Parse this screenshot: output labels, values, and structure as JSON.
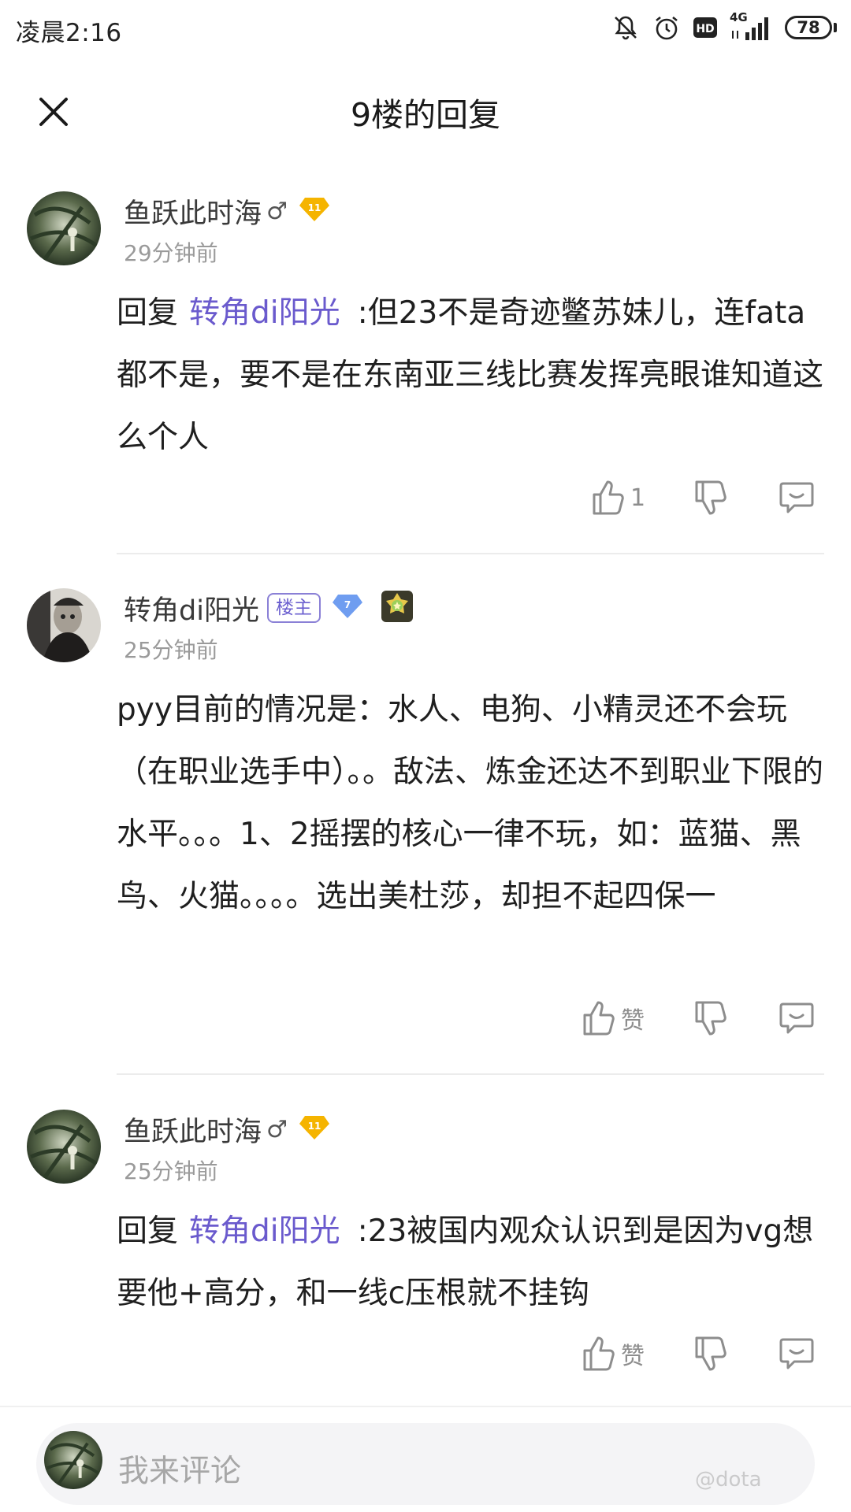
{
  "status_bar": {
    "time": "凌晨2:16",
    "network": "4G",
    "hd": "HD",
    "battery": "78",
    "icons": [
      "mute-icon",
      "alarm-icon",
      "hd-icon",
      "signal-icon",
      "battery-icon"
    ]
  },
  "header": {
    "title": "9楼的回复",
    "close_icon": "close-icon"
  },
  "comments": [
    {
      "username": "鱼跃此时海",
      "gender": "♂",
      "level": "11",
      "time": "29分钟前",
      "reply_prefix": "回复",
      "mention": "转角di阳光",
      "text": ":但23不是奇迹鳖苏妹儿，连fata都不是，要不是在东南亚三线比赛发挥亮眼谁知道这么个人",
      "like_label": "1"
    },
    {
      "username": "转角di阳光",
      "owner_badge": "楼主",
      "level": "7",
      "time": "25分钟前",
      "text": "pyy目前的情况是：水人、电狗、小精灵还不会玩（在职业选手中）。。敌法、炼金还达不到职业下限的水平。。。1、2摇摆的核心一律不玩，如：蓝猫、黑鸟、火猫。。。。选出美杜莎，却担不起四保一",
      "like_label": "赞"
    },
    {
      "username": "鱼跃此时海",
      "gender": "♂",
      "level": "11",
      "time": "25分钟前",
      "reply_prefix": "回复",
      "mention": "转角di阳光",
      "text": ":23被国内观众认识到是因为vg想要他+高分，和一线c压根就不挂钩",
      "like_label": "赞"
    }
  ],
  "colors": {
    "mention": "#6a5acd",
    "gold_badge": "#f5b400",
    "blue_badge": "#6f9df0",
    "muted_text": "#9a9a9a"
  },
  "input": {
    "placeholder": "我来评论"
  },
  "watermark": "@dota"
}
